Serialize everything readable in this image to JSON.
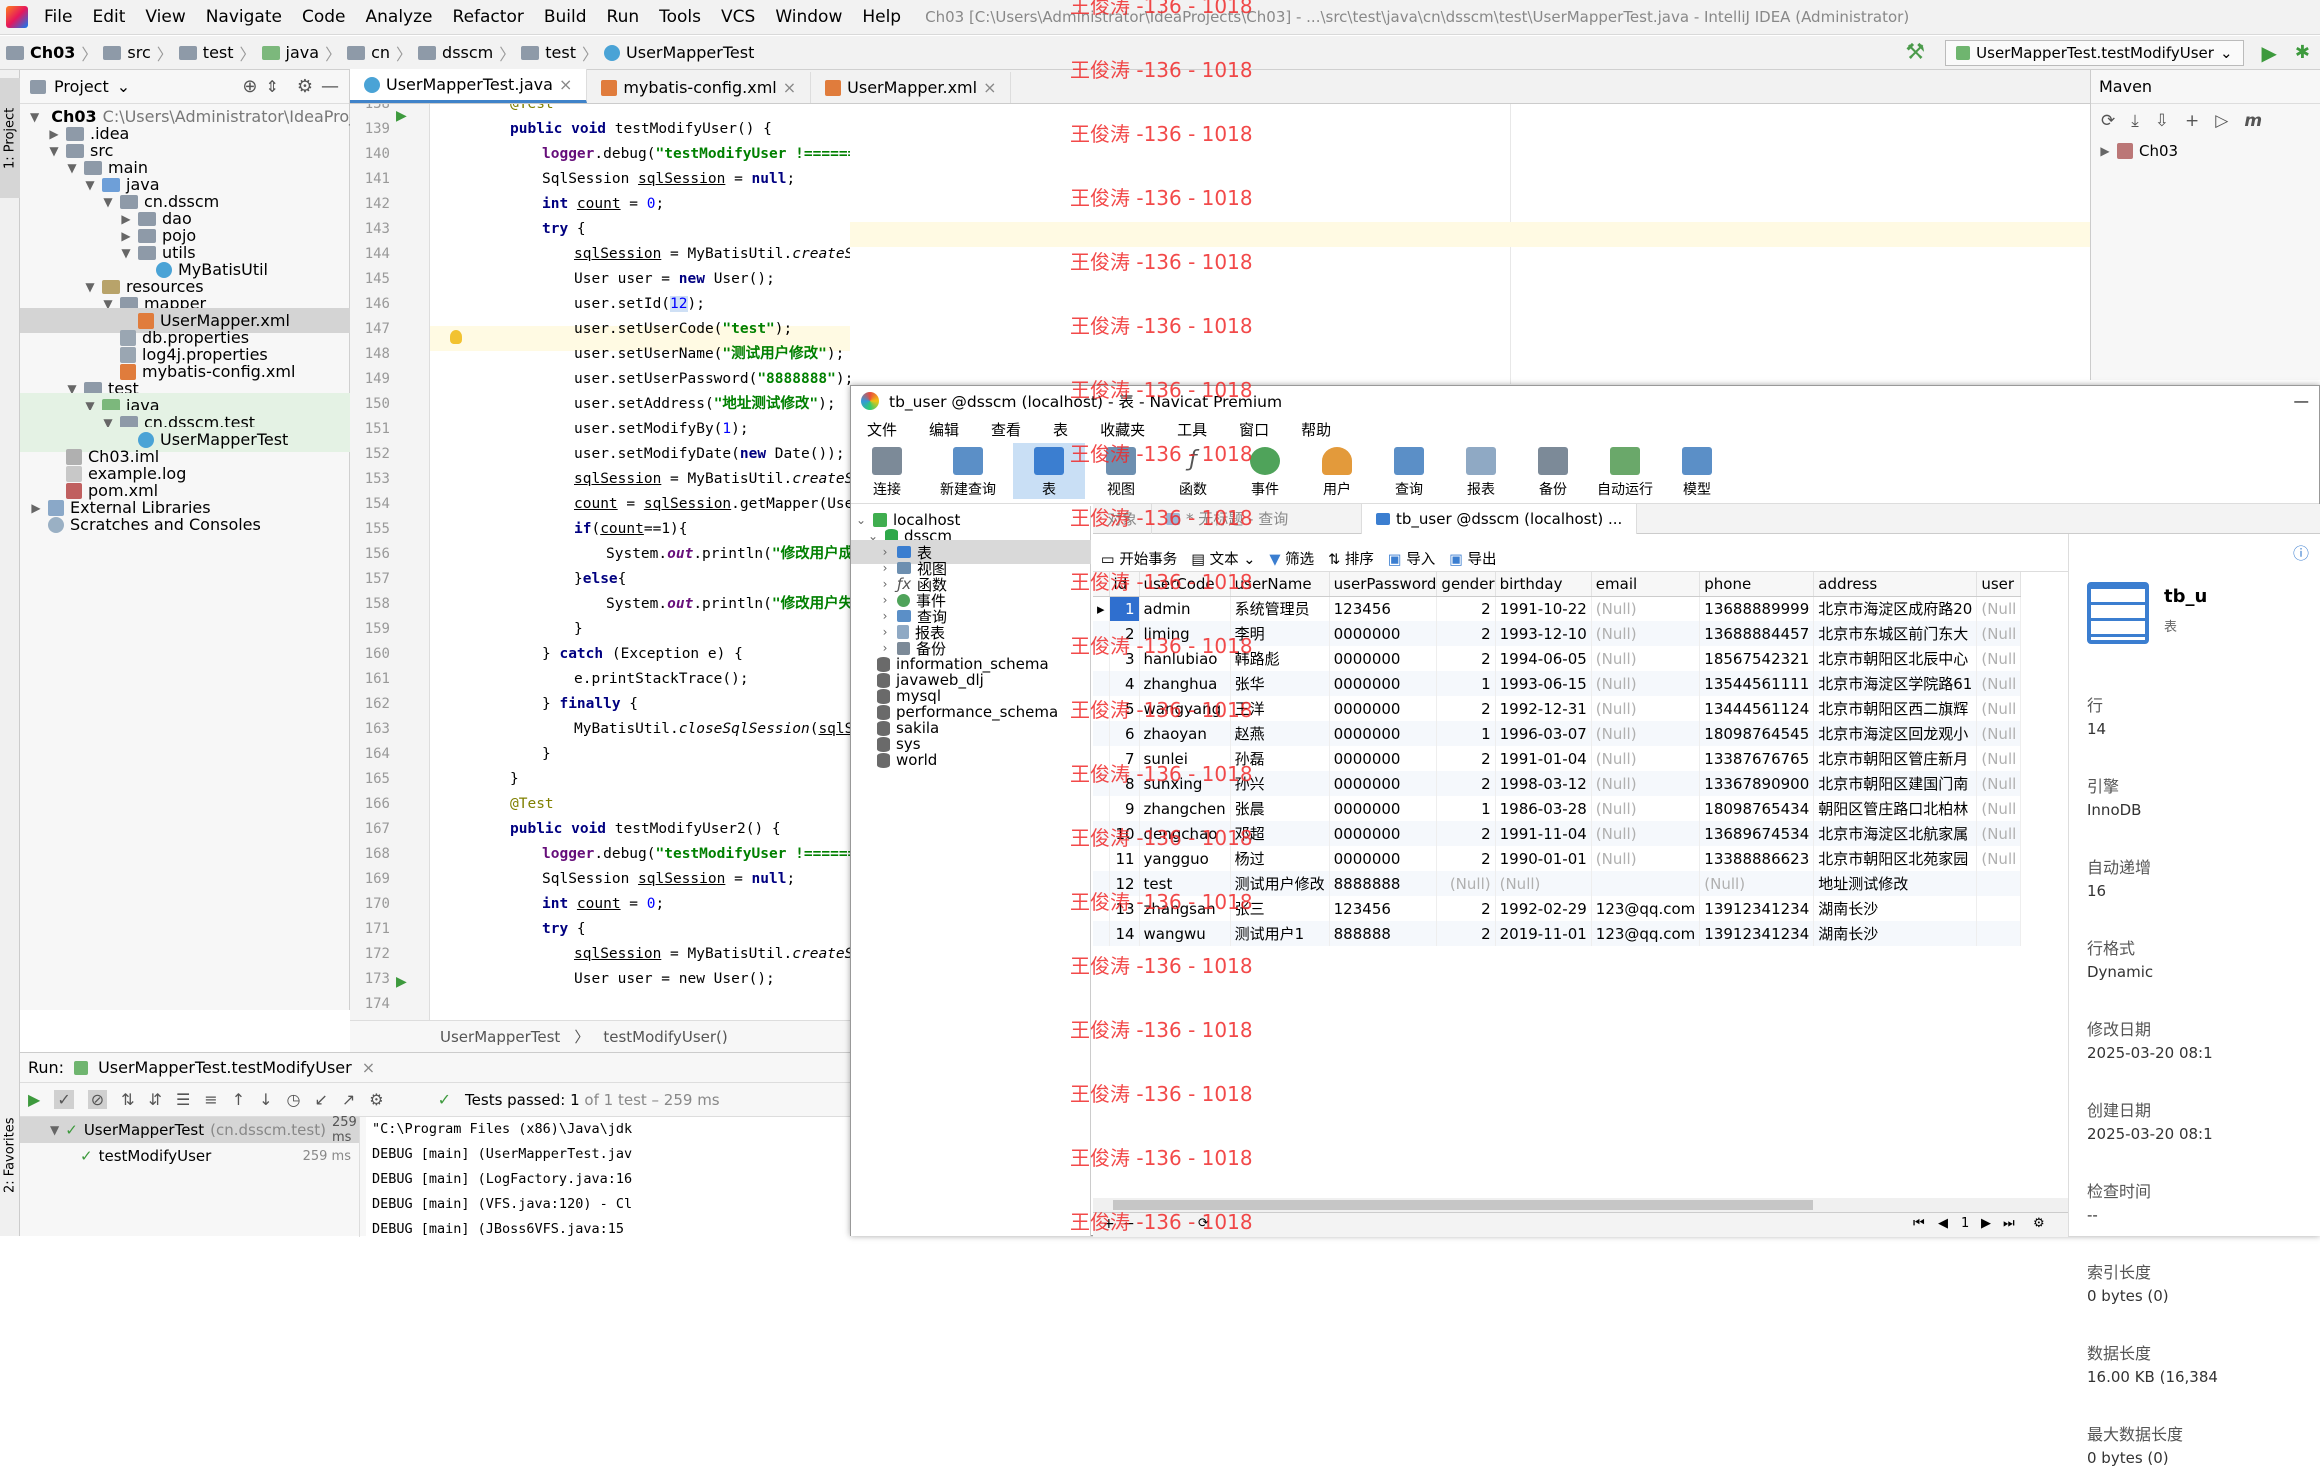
{
  "ide": {
    "menu": [
      "File",
      "Edit",
      "View",
      "Navigate",
      "Code",
      "Analyze",
      "Refactor",
      "Build",
      "Run",
      "Tools",
      "VCS",
      "Window",
      "Help"
    ],
    "window_title": "Ch03 [C:\\Users\\Administrator\\IdeaProjects\\Ch03] - ...\\src\\test\\java\\cn\\dsscm\\test\\UserMapperTest.java - IntelliJ IDEA (Administrator)",
    "breadcrumbs": [
      "Ch03",
      "src",
      "test",
      "java",
      "cn",
      "dsscm",
      "test",
      "UserMapperTest"
    ],
    "run_config": "UserMapperTest.testModifyUser",
    "left_strip": {
      "project": "1: Project",
      "favorites": "2: Favorites"
    },
    "project_panel": {
      "title": "Project",
      "root_name": "Ch03",
      "root_path": "C:\\Users\\Administrator\\IdeaProj",
      "items": [
        ".idea",
        "src",
        "main",
        "java",
        "cn.dsscm",
        "dao",
        "pojo",
        "utils",
        "MyBatisUtil",
        "resources",
        "mapper",
        "UserMapper.xml",
        "db.properties",
        "log4j.properties",
        "mybatis-config.xml",
        "test",
        "java",
        "cn.dsscm.test",
        "UserMapperTest",
        "Ch03.iml",
        "example.log",
        "pom.xml",
        "External Libraries",
        "Scratches and Consoles"
      ]
    },
    "tabs": [
      "UserMapperTest.java",
      "mybatis-config.xml",
      "UserMapper.xml"
    ],
    "line_numbers": [
      "138",
      "139",
      "140",
      "141",
      "142",
      "143",
      "144",
      "145",
      "146",
      "147",
      "148",
      "149",
      "150",
      "151",
      "152",
      "153",
      "154",
      "155",
      "156",
      "157",
      "158",
      "159",
      "160",
      "161",
      "162",
      "163",
      "164",
      "165",
      "166",
      "167",
      "168",
      "169",
      "170",
      "171",
      "172",
      "173",
      "174"
    ],
    "code": {
      "l139": "@Test",
      "l140a": "public void ",
      "l140b": "testModifyUser() {",
      "l141a": "logger",
      "l141b": ".debug(",
      "l141c": "\"testModifyUser !====================\"",
      "l141d": ");",
      "l142a": "SqlSession ",
      "l142b": "sqlSession",
      "l142c": " = ",
      "l142d": "null",
      "l142e": ";",
      "l143a": "int ",
      "l143b": "count",
      "l143c": " = ",
      "l143d": "0",
      "l143e": ";",
      "l144a": "try",
      "l144b": " {",
      "l145a": "sqlSession",
      "l145b": " = MyBatisUtil.",
      "l145c": "createSqlSession",
      "l145d": "();",
      "l146a": "User user = ",
      "l146b": "new",
      "l146c": " User();",
      "l147a": "user.setId(",
      "l147b": "12",
      "l147c": ");",
      "l148a": "user.setUserCode(",
      "l148b": "\"test\"",
      "l148c": ");",
      "l149a": "user.setUserName(",
      "l149b": "\"测试用户修改\"",
      "l149c": ");",
      "l150a": "user.setUserPassword(",
      "l150b": "\"8888888\"",
      "l150c": ");",
      "l151a": "user.setAddress(",
      "l151b": "\"地址测试修改\"",
      "l151c": ");",
      "l152a": "user.setModifyBy(",
      "l152b": "1",
      "l152c": ");",
      "l153a": "user.setModifyDate(",
      "l153b": "new",
      "l153c": " Date());",
      "l154a": "sqlSession",
      "l154b": " = MyBatisUtil.",
      "l154c": "createSqlSe",
      "l155a": "count",
      "l155b": " = ",
      "l155c": "sqlSession",
      "l155d": ".getMapper(UserM",
      "l156a": "if",
      "l156b": "(",
      "l156c": "count",
      "l156d": "==1){",
      "l157a": "System.",
      "l157b": "out",
      "l157c": ".println(",
      "l157d": "\"修改用户成功",
      "l158a": "}",
      "l158b": "else",
      "l158c": "{",
      "l159a": "System.",
      "l159b": "out",
      "l159c": ".println(",
      "l159d": "\"修改用户失败",
      "l160": "}",
      "l161a": "} ",
      "l161b": "catch",
      "l161c": " (Exception e) {",
      "l162": "e.printStackTrace();",
      "l163a": "} ",
      "l163b": "finally",
      "l163c": " {",
      "l164a": "MyBatisUtil.",
      "l164b": "closeSqlSession",
      "l164c": "(",
      "l164d": "sqlSes",
      "l165": "}",
      "l166": "}",
      "l167": "@Test",
      "l168a": "public void ",
      "l168b": "testModifyUser2() {",
      "l169a": "logger",
      "l169b": ".debug(",
      "l169c": "\"testModifyUser !=========",
      "l170a": "SqlSession ",
      "l170b": "sqlSession",
      "l170c": " = ",
      "l170d": "null",
      "l170e": ";",
      "l171a": "int ",
      "l171b": "count",
      "l171c": " = ",
      "l171d": "0",
      "l171e": ";",
      "l172a": "try",
      "l172b": " {",
      "l173a": "sqlSession",
      "l173b": " = MyBatisUtil.",
      "l173c": "createSqlSe",
      "l174": "User user = new User();"
    },
    "code_breadcrumb": [
      "UserMapperTest",
      "testModifyUser()"
    ],
    "maven": {
      "title": "Maven",
      "root": "Ch03"
    },
    "run": {
      "label": "Run:",
      "config": "UserMapperTest.testModifyUser",
      "status_prefix": "Tests passed:",
      "status_count": "1",
      "status_suffix": "of 1 test – 259 ms",
      "tree": [
        {
          "name": "UserMapperTest",
          "detail": "(cn.dsscm.test)",
          "time": "259 ms"
        },
        {
          "name": "testModifyUser",
          "detail": "",
          "time": "259 ms"
        }
      ],
      "console": [
        "\"C:\\Program Files (x86)\\Java\\jdk",
        "DEBUG [main] (UserMapperTest.jav",
        "DEBUG [main] (LogFactory.java:16",
        "DEBUG [main] (VFS.java:120) - Cl",
        "DEBUG [main] (JBoss6VFS.java:15"
      ]
    }
  },
  "navicat": {
    "title": "tb_user @dsscm (localhost) - 表 - Navicat Premium",
    "menu": [
      "文件",
      "编辑",
      "查看",
      "表",
      "收藏夹",
      "工具",
      "窗口",
      "帮助"
    ],
    "toolbar": [
      "连接",
      "新建查询",
      "表",
      "视图",
      "函数",
      "事件",
      "用户",
      "查询",
      "报表",
      "备份",
      "自动运行",
      "模型"
    ],
    "tree": {
      "connection": "localhost",
      "database": "dsscm",
      "groups": [
        "表",
        "视图",
        "函数",
        "事件",
        "查询",
        "报表",
        "备份"
      ],
      "other_dbs": [
        "information_schema",
        "javaweb_dlj",
        "mysql",
        "performance_schema",
        "sakila",
        "sys",
        "world"
      ]
    },
    "object_tabs": [
      "对象",
      "* 无标题 - 查询",
      "tb_user @dsscm (localhost) ..."
    ],
    "sub_toolbar": [
      "开始事务",
      "文本",
      "筛选",
      "排序",
      "导入",
      "导出"
    ],
    "columns": [
      "id",
      "userCode",
      "userName",
      "userPassword",
      "gender",
      "birthday",
      "email",
      "phone",
      "address",
      "user"
    ],
    "rows": [
      [
        "1",
        "admin",
        "系统管理员",
        "123456",
        "2",
        "1991-10-22",
        "(Null)",
        "13688889999",
        "北京市海淀区成府路20",
        "(Null"
      ],
      [
        "2",
        "liming",
        "李明",
        "0000000",
        "2",
        "1993-12-10",
        "(Null)",
        "13688884457",
        "北京市东城区前门东大",
        "(Null"
      ],
      [
        "3",
        "hanlubiao",
        "韩路彪",
        "0000000",
        "2",
        "1994-06-05",
        "(Null)",
        "18567542321",
        "北京市朝阳区北辰中心",
        "(Null"
      ],
      [
        "4",
        "zhanghua",
        "张华",
        "0000000",
        "1",
        "1993-06-15",
        "(Null)",
        "13544561111",
        "北京市海淀区学院路61",
        "(Null"
      ],
      [
        "5",
        "wangyang",
        "王洋",
        "0000000",
        "2",
        "1992-12-31",
        "(Null)",
        "13444561124",
        "北京市朝阳区西二旗辉",
        "(Null"
      ],
      [
        "6",
        "zhaoyan",
        "赵燕",
        "0000000",
        "1",
        "1996-03-07",
        "(Null)",
        "18098764545",
        "北京市海淀区回龙观小",
        "(Null"
      ],
      [
        "7",
        "sunlei",
        "孙磊",
        "0000000",
        "2",
        "1991-01-04",
        "(Null)",
        "13387676765",
        "北京市朝阳区管庄新月",
        "(Null"
      ],
      [
        "8",
        "sunxing",
        "孙兴",
        "0000000",
        "2",
        "1998-03-12",
        "(Null)",
        "13367890900",
        "北京市朝阳区建国门南",
        "(Null"
      ],
      [
        "9",
        "zhangchen",
        "张晨",
        "0000000",
        "1",
        "1986-03-28",
        "(Null)",
        "18098765434",
        "朝阳区管庄路口北柏林",
        "(Null"
      ],
      [
        "10",
        "dengchao",
        "邓超",
        "0000000",
        "2",
        "1991-11-04",
        "(Null)",
        "13689674534",
        "北京市海淀区北航家属",
        "(Null"
      ],
      [
        "11",
        "yangguo",
        "杨过",
        "0000000",
        "2",
        "1990-01-01",
        "(Null)",
        "13388886623",
        "北京市朝阳区北苑家园",
        "(Null"
      ],
      [
        "12",
        "test",
        "测试用户修改",
        "8888888",
        "(Null)",
        "(Null)",
        "",
        "(Null)",
        "地址测试修改",
        ""
      ],
      [
        "13",
        "zhangsan",
        "张三",
        "123456",
        "2",
        "1992-02-29",
        "123@qq.com",
        "13912341234",
        "湖南长沙",
        ""
      ],
      [
        "14",
        "wangwu",
        "测试用户1",
        "888888",
        "2",
        "2019-11-01",
        "123@qq.com",
        "13912341234",
        "湖南长沙",
        ""
      ]
    ],
    "info": {
      "title": "tb_u",
      "subtitle": "表",
      "fields": [
        {
          "k": "行",
          "v": "14"
        },
        {
          "k": "引擎",
          "v": "InnoDB"
        },
        {
          "k": "自动递增",
          "v": "16"
        },
        {
          "k": "行格式",
          "v": "Dynamic"
        },
        {
          "k": "修改日期",
          "v": "2025-03-20 08:1"
        },
        {
          "k": "创建日期",
          "v": "2025-03-20 08:1"
        },
        {
          "k": "检查时间",
          "v": "--"
        },
        {
          "k": "索引长度",
          "v": "0 bytes (0)"
        },
        {
          "k": "数据长度",
          "v": "16.00 KB (16,384"
        },
        {
          "k": "最大数据长度",
          "v": "0 bytes (0)"
        }
      ]
    },
    "pager": "1"
  },
  "watermark": "王俊涛 -136 - 1018",
  "colors": {
    "keyword": "#000080",
    "string": "#008000",
    "annotation": "#808000",
    "field": "#660e7a",
    "watermark": "#f02a2a",
    "accent": "#4083c9"
  }
}
